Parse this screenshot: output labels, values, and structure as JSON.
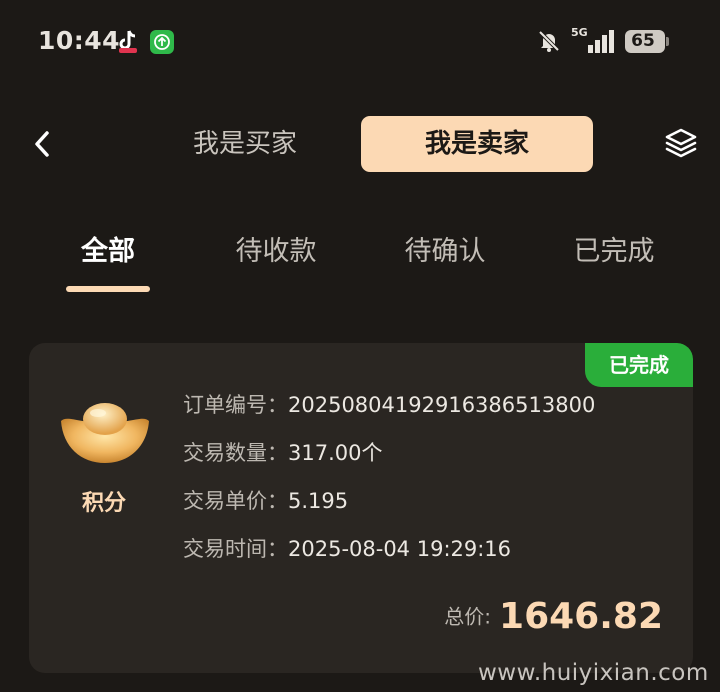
{
  "status_bar": {
    "time": "10:44",
    "network": "5G",
    "battery": "65",
    "icons": [
      "tiktok-icon",
      "green-upload-icon",
      "bell-muted-icon",
      "signal-icon",
      "battery-icon"
    ]
  },
  "header": {
    "back_icon": "chevron-left-icon",
    "role_buyer": "我是买家",
    "role_seller": "我是卖家",
    "selected_role": "seller",
    "menu_icon": "layers-icon"
  },
  "tabs": [
    {
      "label": "全部",
      "active": true
    },
    {
      "label": "待收款",
      "active": false
    },
    {
      "label": "待确认",
      "active": false
    },
    {
      "label": "已完成",
      "active": false
    }
  ],
  "order": {
    "status": "已完成",
    "asset_icon": "gold-ingot-icon",
    "asset_name": "积分",
    "fields": [
      {
        "label": "订单编号：",
        "value": "202508041929163865138​00"
      },
      {
        "label": "交易数量：",
        "value": "317.00个"
      },
      {
        "label": "交易单价：",
        "value": "5.195"
      },
      {
        "label": "交易时间：",
        "value": "2025-08-04 19:29:16"
      }
    ],
    "total_label": "总价:",
    "total_value": "1646.82"
  },
  "watermark": "www.huiyixian.com",
  "colors": {
    "background": "#1c1916",
    "card": "#2a2622",
    "accent": "#fcd9b4",
    "success": "#2aae3a"
  }
}
